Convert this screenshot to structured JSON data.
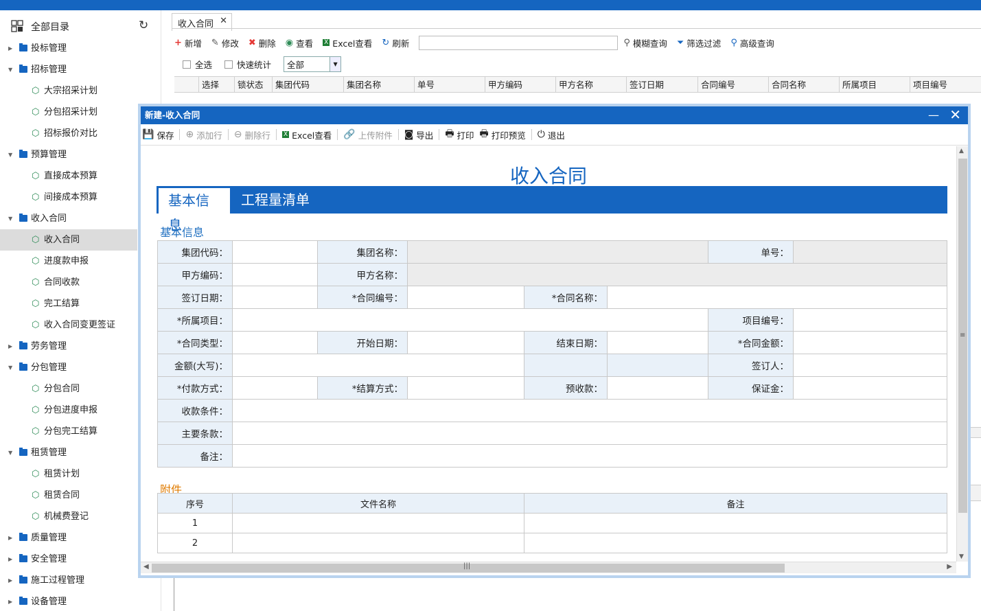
{
  "colors": {
    "accent": "#1565c0",
    "icon_green": "#2e8b57",
    "section_orange": "#e07b00"
  },
  "sidebar": {
    "title": "全部目录",
    "items": [
      {
        "label": "投标管理",
        "type": "group",
        "expanded": false
      },
      {
        "label": "招标管理",
        "type": "group",
        "expanded": true
      },
      {
        "label": "大宗招采计划",
        "type": "leaf"
      },
      {
        "label": "分包招采计划",
        "type": "leaf"
      },
      {
        "label": "招标报价对比",
        "type": "leaf"
      },
      {
        "label": "预算管理",
        "type": "group",
        "expanded": true
      },
      {
        "label": "直接成本预算",
        "type": "leaf"
      },
      {
        "label": "间接成本预算",
        "type": "leaf"
      },
      {
        "label": "收入合同",
        "type": "group",
        "expanded": true
      },
      {
        "label": "收入合同",
        "type": "leaf",
        "selected": true
      },
      {
        "label": "进度款申报",
        "type": "leaf"
      },
      {
        "label": "合同收款",
        "type": "leaf"
      },
      {
        "label": "完工结算",
        "type": "leaf"
      },
      {
        "label": "收入合同变更签证",
        "type": "leaf"
      },
      {
        "label": "劳务管理",
        "type": "group",
        "expanded": false
      },
      {
        "label": "分包管理",
        "type": "group",
        "expanded": true
      },
      {
        "label": "分包合同",
        "type": "leaf"
      },
      {
        "label": "分包进度申报",
        "type": "leaf"
      },
      {
        "label": "分包完工结算",
        "type": "leaf"
      },
      {
        "label": "租赁管理",
        "type": "group",
        "expanded": true
      },
      {
        "label": "租赁计划",
        "type": "leaf"
      },
      {
        "label": "租赁合同",
        "type": "leaf"
      },
      {
        "label": "机械费登记",
        "type": "leaf"
      },
      {
        "label": "质量管理",
        "type": "group",
        "expanded": false
      },
      {
        "label": "安全管理",
        "type": "group",
        "expanded": false
      },
      {
        "label": "施工过程管理",
        "type": "group",
        "expanded": false
      },
      {
        "label": "设备管理",
        "type": "group",
        "expanded": false
      }
    ]
  },
  "main": {
    "tab_label": "收入合同",
    "toolbar": {
      "add": "新增",
      "edit": "修改",
      "delete": "删除",
      "view": "查看",
      "excel": "Excel查看",
      "refresh": "刷新",
      "fuzzy": "模糊查询",
      "filter": "筛选过滤",
      "advanced": "高级查询",
      "search_value": ""
    },
    "select_all": "全选",
    "quick_stats": "快速统计",
    "scope_select": "全部",
    "columns": [
      "选择",
      "锁状态",
      "集团代码",
      "集团名称",
      "单号",
      "甲方编码",
      "甲方名称",
      "签订日期",
      "合同编号",
      "合同名称",
      "所属项目",
      "项目编号"
    ]
  },
  "modal": {
    "title": "新建-收入合同",
    "toolbar": {
      "save": "保存",
      "add_row": "添加行",
      "delete_row": "删除行",
      "excel": "Excel查看",
      "upload": "上传附件",
      "export": "导出",
      "print": "打印",
      "print_preview": "打印预览",
      "exit": "退出"
    },
    "form_title": "收入合同",
    "tabs": [
      "基本信息",
      "工程量清单"
    ],
    "section_basic": "基本信息",
    "labels": {
      "group_code": "集团代码：",
      "group_name": "集团名称：",
      "order_no": "单号：",
      "party_code": "甲方编码：",
      "party_name": "甲方名称：",
      "sign_date": "签订日期：",
      "contract_no": "*合同编号：",
      "contract_name": "*合同名称：",
      "project": "*所属项目：",
      "project_no": "项目编号：",
      "contract_type": "*合同类型：",
      "start_date": "开始日期：",
      "end_date": "结束日期：",
      "amount": "*合同金额：",
      "amount_words": "金额(大写)：",
      "signer": "签订人：",
      "pay_method": "*付款方式：",
      "settle_method": "*结算方式：",
      "prepay": "预收款：",
      "deposit": "保证金：",
      "collect_terms": "收款条件：",
      "main_terms": "主要条款：",
      "remark": "备注："
    },
    "section_attach": "附件",
    "attach_columns": [
      "序号",
      "文件名称",
      "备注"
    ],
    "attach_rows": [
      {
        "no": "1",
        "file": "",
        "note": ""
      },
      {
        "no": "2",
        "file": "",
        "note": ""
      }
    ]
  }
}
